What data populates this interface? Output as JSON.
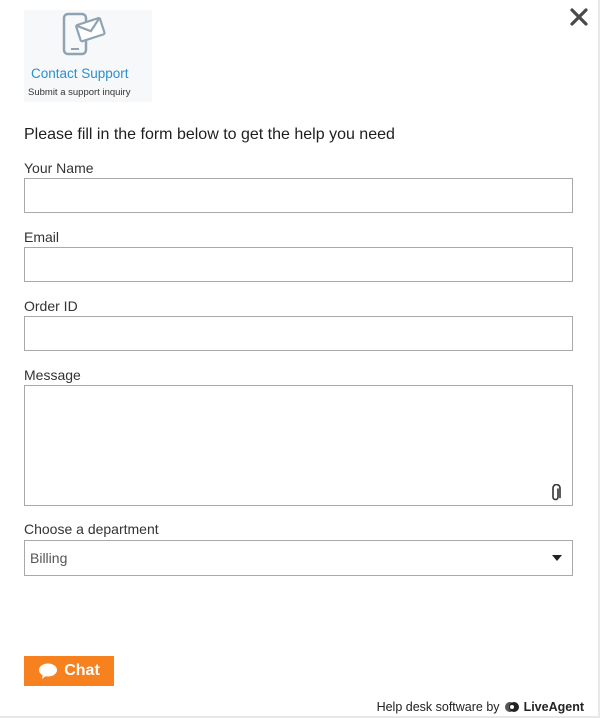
{
  "header": {
    "title": "Contact Support",
    "subtitle": "Submit a support inquiry",
    "logo_icon": "phone-envelope-icon",
    "close_icon": "close-icon"
  },
  "form": {
    "intro": "Please fill in the form below to get the help you need",
    "name_label": "Your Name",
    "name_value": "",
    "email_label": "Email",
    "email_value": "",
    "order_label": "Order ID",
    "order_value": "",
    "message_label": "Message",
    "message_value": "",
    "attach_icon": "paperclip-icon",
    "department_label": "Choose a department",
    "department_value": "Billing"
  },
  "chat_button": {
    "label": "Chat",
    "icon": "speech-bubble-icon"
  },
  "footer": {
    "text": "Help desk software by",
    "brand": "LiveAgent",
    "brand_icon": "liveagent-logo-icon"
  },
  "colors": {
    "accent": "#f7811e",
    "brand_blue": "#2a8fd0",
    "border": "#a9a9a9"
  }
}
